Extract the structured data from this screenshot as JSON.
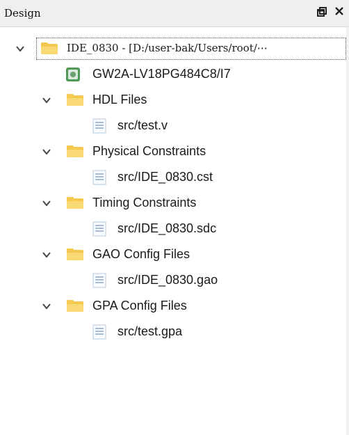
{
  "panel": {
    "title": "Design",
    "float_icon": "float-window-icon",
    "close_icon": "close-icon"
  },
  "tree": {
    "root": {
      "label": "IDE_0830 - [D:/user-bak/Users/root/⋯"
    },
    "device": {
      "label": "GW2A-LV18PG484C8/I7",
      "icon": "device-chip-icon"
    },
    "groups": [
      {
        "label": "HDL Files",
        "files": [
          "src/test.v"
        ]
      },
      {
        "label": "Physical Constraints",
        "files": [
          "src/IDE_0830.cst"
        ]
      },
      {
        "label": "Timing Constraints",
        "files": [
          "src/IDE_0830.sdc"
        ]
      },
      {
        "label": "GAO Config Files",
        "files": [
          "src/IDE_0830.gao"
        ]
      },
      {
        "label": "GPA Config Files",
        "files": [
          "src/test.gpa"
        ]
      }
    ]
  },
  "colors": {
    "folder": "#f7cf63",
    "folder_dark": "#e9b646",
    "file_line": "#8aa6c8",
    "chip_green": "#4f9a57"
  }
}
